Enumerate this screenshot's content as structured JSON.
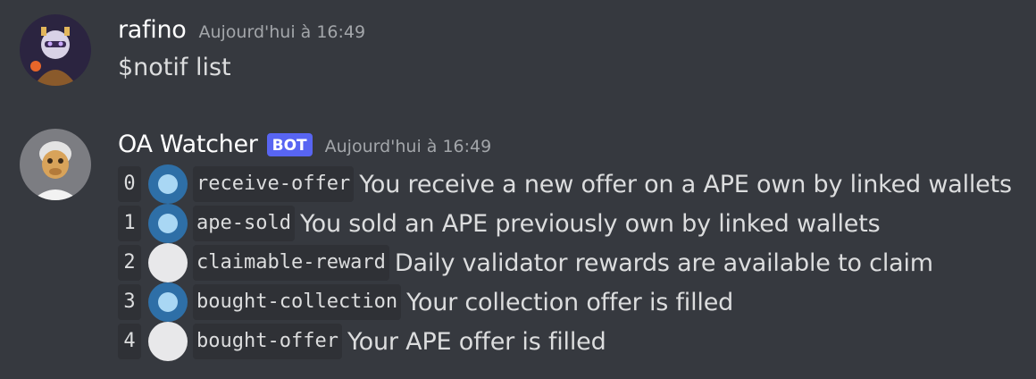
{
  "messages": [
    {
      "author": "rafino",
      "timestamp": "Aujourd'hui à 16:49",
      "content": "$notif list"
    },
    {
      "author": "OA Watcher",
      "bot_tag": "BOT",
      "timestamp": "Aujourd'hui à 16:49",
      "lines": [
        {
          "index": "0",
          "enabled": true,
          "code": "receive-offer",
          "text": "You receive a new offer on a APE own by linked wallets"
        },
        {
          "index": "1",
          "enabled": true,
          "code": "ape-sold",
          "text": "You sold an APE previously own by linked wallets"
        },
        {
          "index": "2",
          "enabled": false,
          "code": "claimable-reward",
          "text": "Daily validator rewards are available to claim"
        },
        {
          "index": "3",
          "enabled": true,
          "code": "bought-collection",
          "text": "Your collection offer is filled"
        },
        {
          "index": "4",
          "enabled": false,
          "code": "bought-offer",
          "text": "Your APE offer is filled"
        }
      ]
    }
  ],
  "colors": {
    "background": "#36393f",
    "code_background": "#2f3136",
    "bot_tag": "#5865f2",
    "enabled_dot": "#2e6fa7",
    "disabled_dot": "#e8e8ea"
  }
}
